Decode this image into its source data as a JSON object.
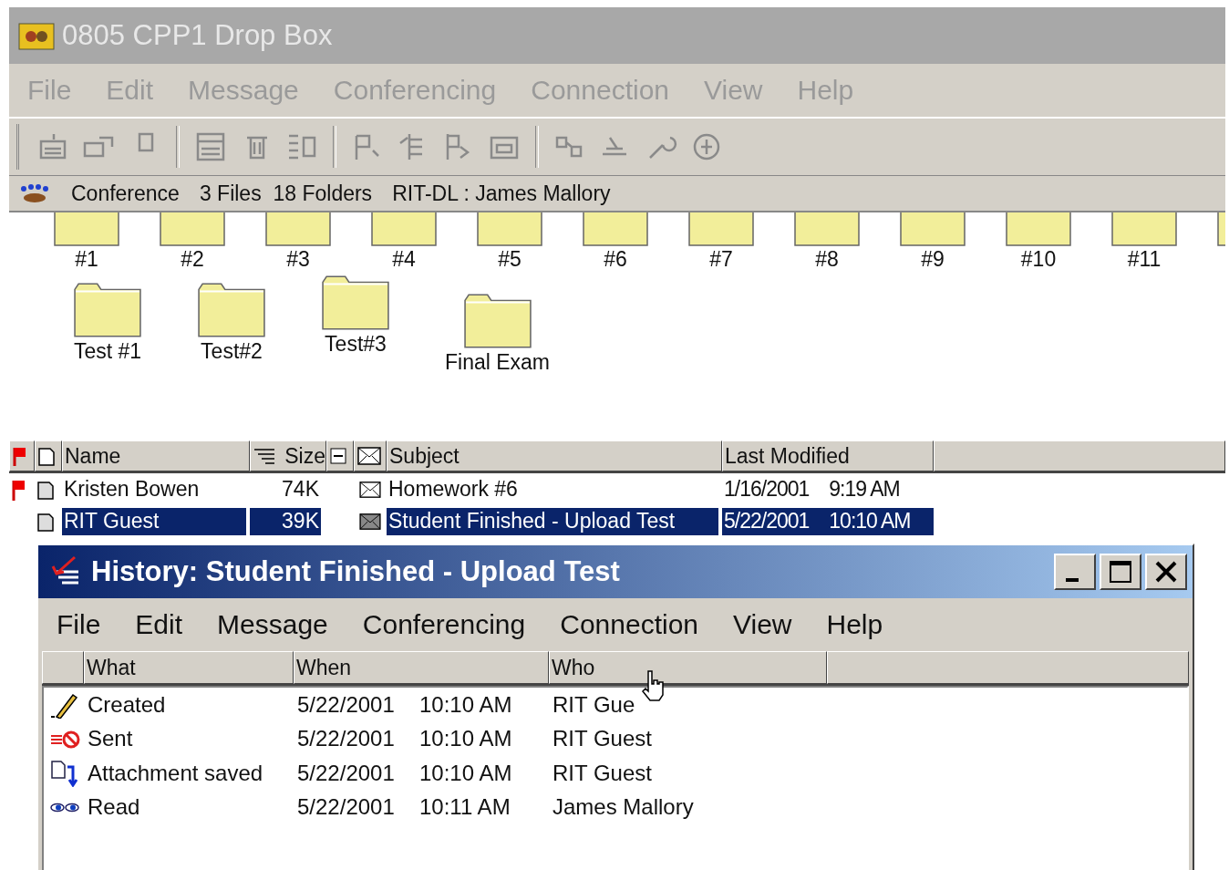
{
  "window": {
    "title": "0805 CPP1 Drop Box"
  },
  "menu": [
    "File",
    "Edit",
    "Message",
    "Conferencing",
    "Connection",
    "View",
    "Help"
  ],
  "toolbar": {
    "disabled": true
  },
  "status": {
    "type": "Conference",
    "files": "3 Files",
    "folders": "18 Folders",
    "location": "RIT-DL : James Mallory"
  },
  "folders_top": [
    "#1",
    "#2",
    "#3",
    "#4",
    "#5",
    "#6",
    "#7",
    "#8",
    "#9",
    "#10",
    "#11"
  ],
  "folders": [
    "Test #1",
    "Test#2",
    "Test#3",
    "Final Exam"
  ],
  "list": {
    "columns": [
      "Name",
      "Size",
      "Subject",
      "Last Modified"
    ],
    "rows": [
      {
        "flagged": true,
        "selected": false,
        "name": "Kristen Bowen",
        "size": "74K",
        "subject": "Homework #6",
        "date": "1/16/2001",
        "time": "9:19 AM"
      },
      {
        "flagged": false,
        "selected": true,
        "name": "RIT Guest",
        "size": "39K",
        "subject": "Student Finished - Upload Test",
        "date": "5/22/2001",
        "time": "10:10 AM"
      }
    ]
  },
  "history": {
    "title": "History: Student Finished - Upload Test",
    "menu": [
      "File",
      "Edit",
      "Message",
      "Conferencing",
      "Connection",
      "View",
      "Help"
    ],
    "columns": [
      "What",
      "When",
      "Who"
    ],
    "rows": [
      {
        "kind": "created",
        "what": "Created",
        "date": "5/22/2001",
        "time": "10:10 AM",
        "who": "RIT Gue"
      },
      {
        "kind": "sent",
        "what": "Sent",
        "date": "5/22/2001",
        "time": "10:10 AM",
        "who": "RIT Guest"
      },
      {
        "kind": "attachment",
        "what": "Attachment saved",
        "date": "5/22/2001",
        "time": "10:10 AM",
        "who": "RIT Guest"
      },
      {
        "kind": "read",
        "what": "Read",
        "date": "5/22/2001",
        "time": "10:11 AM",
        "who": "James Mallory"
      }
    ]
  }
}
